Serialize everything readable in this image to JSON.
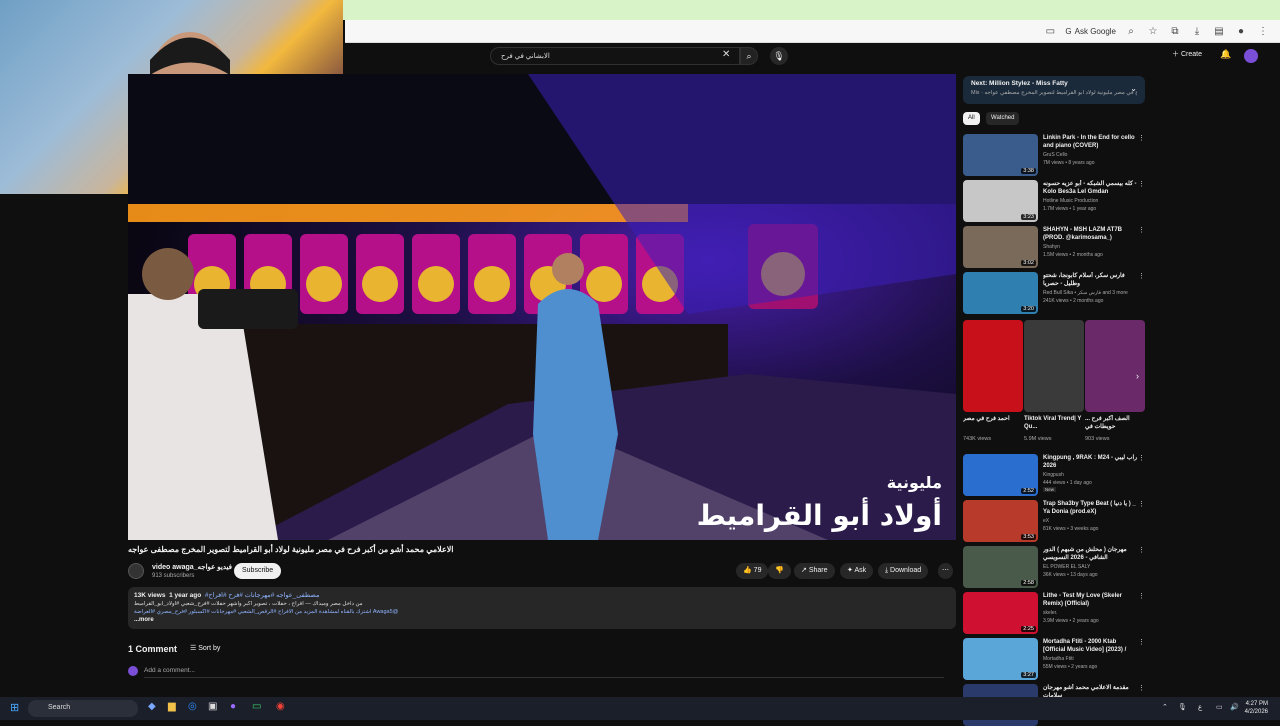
{
  "browser": {
    "ask_google": "Ask Google"
  },
  "header": {
    "search_query": "الابشاني في فرح",
    "create_label": "Create"
  },
  "video": {
    "title": "الاعلامي محمد أشو من أكبر فرح في مصر مليونية لولاد أبو القراميط لتصوير المخرج مصطفى عواجه",
    "overlay_small": "مليونية",
    "overlay_big": "أولاد أبو القراميط",
    "channel_name": "video awaga_فيديو عواجه",
    "subscribers": "913 subscribers",
    "subscribe_label": "Subscribe",
    "likes": "79",
    "share_label": "Share",
    "ask_label": "Ask",
    "download_label": "Download"
  },
  "description": {
    "views": "13K views",
    "age": "1 year ago",
    "line1": "#مصطفى_عواجه #مهرجانات #فرح #افراح",
    "line2": "من داخل مصر وميداك — افراح ، حفلات ، تصوير أكبر وأشهر حفلات #فرح_شعبي #أولاد_أبو_القراميط",
    "line3": "@Awaga5 اشترك بالقناه لمشاهدة المزيد من الافراح #الرقص_الشعبي #مهرجانات #اكسبلور #فرح_مصري #العراضة",
    "more": "...more"
  },
  "comments": {
    "count_label": "1 Comment",
    "sort_label": "Sort by",
    "add_placeholder": "Add a comment..."
  },
  "sidebar": {
    "next_title": "Next: Million Stylez - Miss Fatty",
    "next_sub": "Mix · فرح في مصر مليونية لولاد أبو القراميط لتصوير المخرج مصطفي عواجه",
    "chips": [
      "All",
      "Watched"
    ],
    "recommendations": [
      {
        "title": "Linkin Park - In the End for cello and piano (COVER)",
        "channel": "GruS Cello",
        "meta": "7M views • 8 years ago",
        "duration": "3:38",
        "thumb": "#3a5c8c"
      },
      {
        "title": "كله بيسمي الشبكه - أبو عزيه حسونه - Kolo Bes3a Lel Gmdan",
        "channel": "Hotline Music Production",
        "meta": "1.7M views • 1 year ago",
        "duration": "3:23",
        "thumb": "#c7c7c7"
      },
      {
        "title": "SHAHYN - MSH LAZM AT7B (PROD. @karimosama_)",
        "channel": "Shahyn",
        "meta": "1.5M views • 2 months ago",
        "duration": "3:02",
        "thumb": "#7a6a5a"
      },
      {
        "title": "فارس سكر، أسلام كابونجا، شحتو وطليل - حصريا",
        "channel": "Red Bull Sika • فارس سكر and 3 more",
        "meta": "241K views • 2 months ago",
        "duration": "3:20",
        "thumb": "#2f7fb0"
      },
      {
        "title": "Kingpung , 9RAK : M24 - راب ليبي 2026",
        "channel": "Kingpush",
        "meta": "444 views • 1 day ago",
        "duration": "2:52",
        "thumb": "#2a6fd0",
        "badge": "New"
      },
      {
        "title": "Trap Sha3by Type Beat ( يا دنيا ) _ Ya Donia (prod.eX)",
        "channel": "eX",
        "meta": "81K views • 3 weeks ago",
        "duration": "3:53",
        "thumb": "#b83a2a"
      },
      {
        "title": "مهرجان ( محلش من شبهم ) الدور الشافي - 2026 النسويسي",
        "channel": "EL POWER EL SALY",
        "meta": "36K views • 13 days ago",
        "duration": "2:58",
        "thumb": "#4a5a4a"
      },
      {
        "title": "Lithe - Test My Love (Skeler Remix) (Official)",
        "channel": "skeler.",
        "meta": "3.9M views • 2 years ago",
        "duration": "2:25",
        "thumb": "#d01030"
      },
      {
        "title": "Mortadha Ftiti - 2000 Ktab [Official Music Video] (2023) / 2000 كتاب",
        "channel": "Mortadha Ftiti",
        "meta": "55M views • 2 years ago",
        "duration": "3:27",
        "thumb": "#5aa6d8"
      },
      {
        "title": "مقدمة الاعلامي محمد أشو مهرجان سلامات",
        "channel": "",
        "meta": "",
        "duration": "",
        "thumb": "#2a3a6a"
      }
    ],
    "shorts": [
      {
        "title": "احمد فرح في مصر",
        "views": "743K views",
        "thumb": "#c8101a"
      },
      {
        "title": "Tiktok Viral Trend| Y Qu...",
        "views": "5.9M views",
        "thumb": "#3a3a3a"
      },
      {
        "title": "الصف أكبر فرح ... حويطات في",
        "views": "903 views",
        "thumb": "#6a2a6a"
      }
    ]
  },
  "taskbar": {
    "search_label": "Search",
    "time": "4:27 PM",
    "date": "4/2/2026",
    "lang": "ع"
  }
}
